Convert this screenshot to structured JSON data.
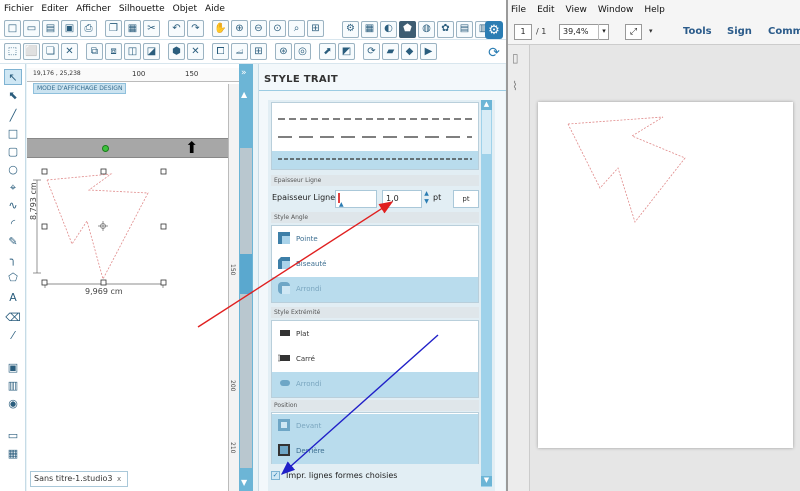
{
  "menu": [
    "Fichier",
    "Editer",
    "Afficher",
    "Silhouette",
    "Objet",
    "Aide"
  ],
  "canvas": {
    "coords": "19,176 , 25,238",
    "ruler_ticks": [
      "100",
      "150"
    ],
    "mode_badge": "MODE D'AFFICHAGE DESIGN",
    "dim_height": "8,793 cm",
    "dim_width": "9,969 cm",
    "tab_label": "Sans titre-1.studio3",
    "tab_close": "x"
  },
  "vruler_ticks": [
    "150",
    "200",
    "210"
  ],
  "panel": {
    "title": "STYLE TRAIT",
    "sections": {
      "epaisseur": "Epaisseur Ligne",
      "angle": "Style Angle",
      "extremite": "Style Extrémité",
      "position": "Position"
    },
    "epaisseur_label": "Epaisseur Ligne",
    "epaisseur_value": "1,0",
    "epaisseur_unit": "pt",
    "unit_button": "pt",
    "angle_options": [
      {
        "label": "Pointe",
        "selected": false
      },
      {
        "label": "Biseauté",
        "selected": false
      },
      {
        "label": "Arrondi",
        "selected": true
      }
    ],
    "extremite_options": [
      {
        "label": "Plat",
        "selected": false
      },
      {
        "label": "Carré",
        "selected": false
      },
      {
        "label": "Arrondi",
        "selected": true
      }
    ],
    "position_options": [
      {
        "label": "Devant",
        "selected": true
      },
      {
        "label": "Derrière",
        "selected": true
      }
    ],
    "checkbox_label": "Impr. lignes formes choisies",
    "checkbox_checked": true
  },
  "acrobat": {
    "menu": [
      "File",
      "Edit",
      "View",
      "Window",
      "Help"
    ],
    "page_current": "1",
    "page_total": "/ 1",
    "zoom": "39,4%",
    "links": [
      "Tools",
      "Sign",
      "Comm"
    ]
  },
  "colors": {
    "accent": "#6cb5d6",
    "selected_row": "#b9dced",
    "shape_stroke": "#e08a8a",
    "annotation_red": "#e02020",
    "annotation_blue": "#2020c8"
  }
}
